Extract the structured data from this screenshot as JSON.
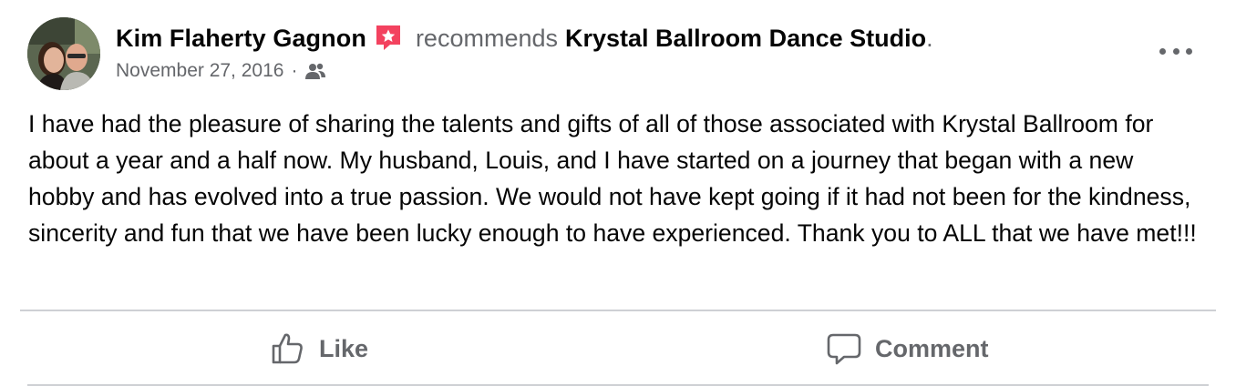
{
  "post": {
    "author": "Kim Flaherty Gagnon",
    "recommends_word": "recommends",
    "page_name": "Krystal Ballroom Dance Studio",
    "trailing_period": ".",
    "date": "November 27, 2016",
    "separator": "·",
    "audience_icon": "friends-icon",
    "recommend_badge_icon": "recommendation-star-icon",
    "badge_color": "#f3425f",
    "body": "I have had the pleasure of sharing the talents and gifts of all of those associated with Krystal Ballroom for about a year and a half now. My husband, Louis, and I have started on a journey that began with a new hobby and has evolved into a true passion. We would not have kept going if it had not been for the kindness, sincerity and fun that we have been lucky enough to have experienced. Thank you to ALL that we have met!!!"
  },
  "actions": {
    "like_label": "Like",
    "like_icon": "thumbs-up-icon",
    "comment_label": "Comment",
    "comment_icon": "speech-bubble-icon",
    "more_icon": "more-options-icon"
  }
}
